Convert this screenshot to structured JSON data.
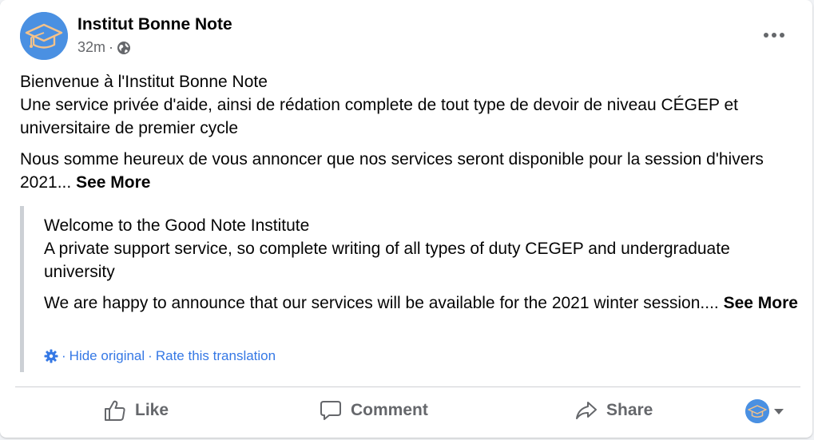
{
  "post": {
    "page_name": "Institut Bonne Note",
    "time": "32m",
    "dot": "·",
    "body": {
      "line1": "Bienvenue à l'Institut Bonne Note",
      "line2": "Une service privée d'aide, ainsi de rédation complete de tout type de devoir de niveau CÉGEP et universitaire de premier cycle",
      "para2": "Nous somme heureux de vous annoncer que nos services seront disponible pour la session d'hivers 2021...",
      "see_more": "See More"
    },
    "translation": {
      "line1": "Welcome to the Good Note Institute",
      "line2": "A private support service, so complete writing of all types of duty CEGEP and undergraduate university",
      "para2": "We are happy to announce that our services will be available for the 2021 winter session....",
      "see_more": "See More",
      "hide_original": "Hide original",
      "rate": "Rate this translation",
      "sep": "·"
    }
  },
  "actions": {
    "like": "Like",
    "comment": "Comment",
    "share": "Share"
  },
  "icons": {
    "avatar": "graduation-cap-logo",
    "privacy": "globe-icon",
    "more": "more-options-icon",
    "translation_settings": "gear-icon",
    "like": "thumbs-up-icon",
    "comment": "comment-bubble-icon",
    "share": "share-arrow-icon",
    "audience_caret": "caret-down-icon"
  },
  "colors": {
    "brand_blue": "#4a90e2",
    "link": "#3578e5",
    "secondary_text": "#65676b",
    "quote_bar": "#ccd0d5"
  }
}
